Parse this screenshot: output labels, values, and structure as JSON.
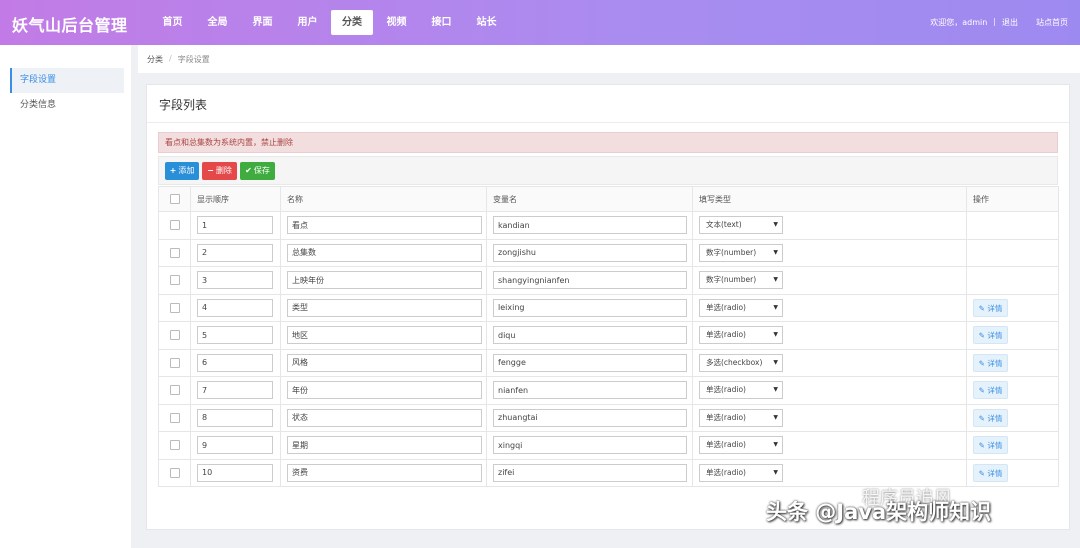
{
  "app": {
    "title": "妖气山后台管理"
  },
  "nav": [
    {
      "label": "首页",
      "active": false
    },
    {
      "label": "全局",
      "active": false
    },
    {
      "label": "界面",
      "active": false
    },
    {
      "label": "用户",
      "active": false
    },
    {
      "label": "分类",
      "active": true
    },
    {
      "label": "视频",
      "active": false
    },
    {
      "label": "接口",
      "active": false
    },
    {
      "label": "站长",
      "active": false
    }
  ],
  "user": {
    "welcome": "欢迎您，admin",
    "separator": "|",
    "logout": "退出",
    "site_home": "站点首页"
  },
  "sidebar": [
    {
      "label": "字段设置",
      "active": true
    },
    {
      "label": "分类信息",
      "active": false
    }
  ],
  "breadcrumb": {
    "parent": "分类",
    "separator": "/",
    "current": "字段设置"
  },
  "panel": {
    "title": "字段列表"
  },
  "alert": {
    "text": "看点和总集数为系统内置，禁止删除"
  },
  "toolbar": {
    "add_label": "添加",
    "add_icon": "plus-icon",
    "delete_label": "删除",
    "delete_icon": "minus-icon",
    "save_label": "保存",
    "save_icon": "check-icon"
  },
  "table": {
    "headers": [
      "显示顺序",
      "名称",
      "变量名",
      "填写类型",
      "操作"
    ],
    "detail_label": "详情",
    "rows": [
      {
        "order": "1",
        "name": "看点",
        "var": "kandian",
        "type": "文本(text)",
        "has_detail": false
      },
      {
        "order": "2",
        "name": "总集数",
        "var": "zongjishu",
        "type": "数字(number)",
        "has_detail": false
      },
      {
        "order": "3",
        "name": "上映年份",
        "var": "shangyingnianfen",
        "type": "数字(number)",
        "has_detail": false
      },
      {
        "order": "4",
        "name": "类型",
        "var": "leixing",
        "type": "单选(radio)",
        "has_detail": true
      },
      {
        "order": "5",
        "name": "地区",
        "var": "diqu",
        "type": "单选(radio)",
        "has_detail": true
      },
      {
        "order": "6",
        "name": "风格",
        "var": "fengge",
        "type": "多选(checkbox)",
        "has_detail": true
      },
      {
        "order": "7",
        "name": "年份",
        "var": "nianfen",
        "type": "单选(radio)",
        "has_detail": true
      },
      {
        "order": "8",
        "name": "状态",
        "var": "zhuangtai",
        "type": "单选(radio)",
        "has_detail": true
      },
      {
        "order": "9",
        "name": "星期",
        "var": "xingqi",
        "type": "单选(radio)",
        "has_detail": true
      },
      {
        "order": "10",
        "name": "资费",
        "var": "zifei",
        "type": "单选(radio)",
        "has_detail": true
      }
    ]
  },
  "watermark": {
    "text": "头条 @Java架构师知识",
    "text2": "程序员追风"
  },
  "colors": {
    "header_start": "#c27be6",
    "header_end": "#9d8af0",
    "primary": "#2a8fd9",
    "danger": "#e54848",
    "success": "#3fac3f"
  }
}
